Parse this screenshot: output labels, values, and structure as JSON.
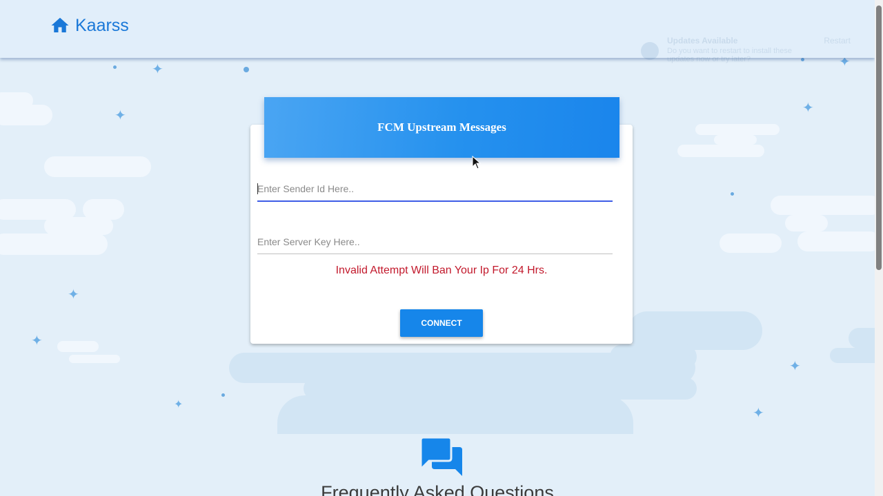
{
  "header": {
    "brand_name": "Kaarss",
    "brand_icon": "home-icon",
    "brand_color": "#1a78d8"
  },
  "notification": {
    "title": "Updates Available",
    "message": "Do you want to restart to install these updates now or try later?",
    "action_label": "Restart"
  },
  "card": {
    "title": "FCM Upstream Messages",
    "sender_id_placeholder": "Enter Sender Id Here..",
    "server_key_placeholder": "Enter Server Key Here..",
    "warning_text": "Invalid Attempt Will Ban Your Ip For 24 Hrs.",
    "connect_label": "CONNECT",
    "header_color": "#2591ee",
    "warning_color": "#c2182b",
    "button_color": "#1686ea"
  },
  "faq": {
    "icon": "chat-bubbles-icon",
    "title": "Frequently Asked Questions",
    "icon_color": "#1686ea"
  }
}
